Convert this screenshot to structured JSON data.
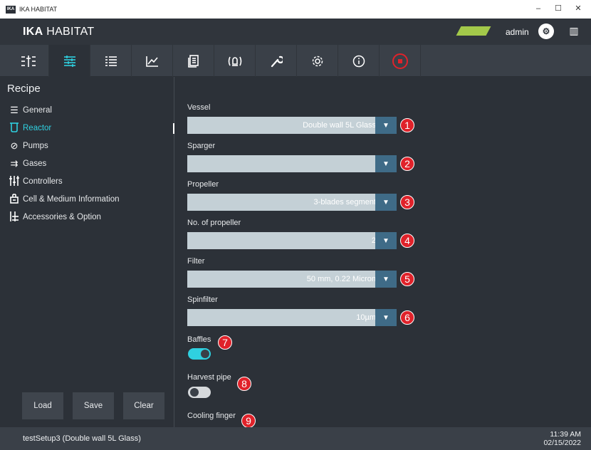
{
  "window": {
    "title": "IKA HABITAT",
    "app_icon_text": "IKA",
    "controls": [
      "–",
      "☐",
      "✕"
    ]
  },
  "header": {
    "brand_bold": "IKA",
    "brand_rest": " HABITAT",
    "status_color": "#a3c94a",
    "user": "admin",
    "avatar_icon": "user-gear-icon",
    "right_icon": "book-icon"
  },
  "toolbar": {
    "buttons": [
      {
        "icon": "overview-icon",
        "glyph": "☷"
      },
      {
        "icon": "recipe-settings-icon",
        "glyph": "☰",
        "active": true
      },
      {
        "icon": "list-icon",
        "glyph": "≣"
      },
      {
        "icon": "chart-icon",
        "glyph": "⟋"
      },
      {
        "icon": "document-icon",
        "glyph": "▤"
      },
      {
        "icon": "alarm-icon",
        "glyph": "((◇))"
      },
      {
        "icon": "wrench-icon",
        "glyph": "✎"
      },
      {
        "icon": "gear-icon",
        "glyph": "⚙"
      },
      {
        "icon": "info-icon",
        "glyph": "ⓘ"
      },
      {
        "icon": "stop-icon",
        "glyph": ""
      }
    ]
  },
  "sidebar": {
    "title": "Recipe",
    "items": [
      {
        "label": "General",
        "glyph": "☰"
      },
      {
        "label": "Reactor",
        "glyph": "⊔",
        "active": true
      },
      {
        "label": "Pumps",
        "glyph": "⊘"
      },
      {
        "label": "Gases",
        "glyph": "⊃"
      },
      {
        "label": "Controllers",
        "glyph": "⫶"
      },
      {
        "label": "Cell & Medium Information",
        "glyph": "⌂"
      },
      {
        "label": "Accessories & Option",
        "glyph": "⊥"
      }
    ],
    "buttons": {
      "load": "Load",
      "save": "Save",
      "clear": "Clear"
    }
  },
  "form": {
    "vessel": {
      "label": "Vessel",
      "value": "Double wall 5L Glass",
      "marker": "1"
    },
    "sparger": {
      "label": "Sparger",
      "value": "",
      "marker": "2"
    },
    "propeller": {
      "label": "Propeller",
      "value": "3-blades segment",
      "marker": "3"
    },
    "num_propeller": {
      "label": "No. of propeller",
      "value": "2",
      "marker": "4"
    },
    "filter": {
      "label": "Filter",
      "value": "50 mm, 0.22 Micron",
      "marker": "5"
    },
    "spinfilter": {
      "label": "Spinfilter",
      "value": "10µm",
      "marker": "6"
    },
    "baffles": {
      "label": "Baffles",
      "on": true,
      "marker": "7"
    },
    "harvest_pipe": {
      "label": "Harvest pipe",
      "on": false,
      "marker": "8"
    },
    "cooling_finger": {
      "label": "Cooling finger",
      "marker": "9"
    }
  },
  "statusbar": {
    "text": "testSetup3 (Double wall 5L Glass)",
    "time": "11:39 AM",
    "date": "02/15/2022"
  }
}
